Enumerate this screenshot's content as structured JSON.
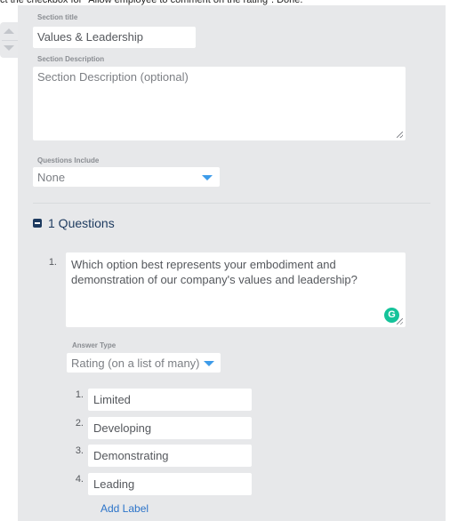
{
  "instruction_text": "ct the checkbox for \"Allow employee to comment on the rating\". Done.",
  "section": {
    "title_label": "Section title",
    "title_value": "Values & Leadership",
    "description_label": "Section Description",
    "description_placeholder": "Section Description (optional)",
    "questions_include_label": "Questions Include",
    "questions_include_value": "None"
  },
  "questions": {
    "heading": "1 Questions",
    "items": [
      {
        "number": "1.",
        "text": "Which option best represents your embodiment and demonstration of our company's values and leadership?",
        "answer_type_label": "Answer Type",
        "answer_type_value": "Rating (on a list of many)",
        "rating_labels": [
          {
            "number": "1.",
            "value": "Limited"
          },
          {
            "number": "2.",
            "value": "Developing"
          },
          {
            "number": "3.",
            "value": "Demonstrating"
          },
          {
            "number": "4.",
            "value": "Leading"
          }
        ],
        "add_label_text": "Add Label"
      }
    ]
  },
  "icons": {
    "grammarly": "G"
  },
  "colors": {
    "panel_bg": "#e7e8ea",
    "accent_blue": "#3d9be9",
    "link_blue": "#2c74c9",
    "heading_navy": "#1d3a5f",
    "grammarly_green": "#15c39a"
  }
}
